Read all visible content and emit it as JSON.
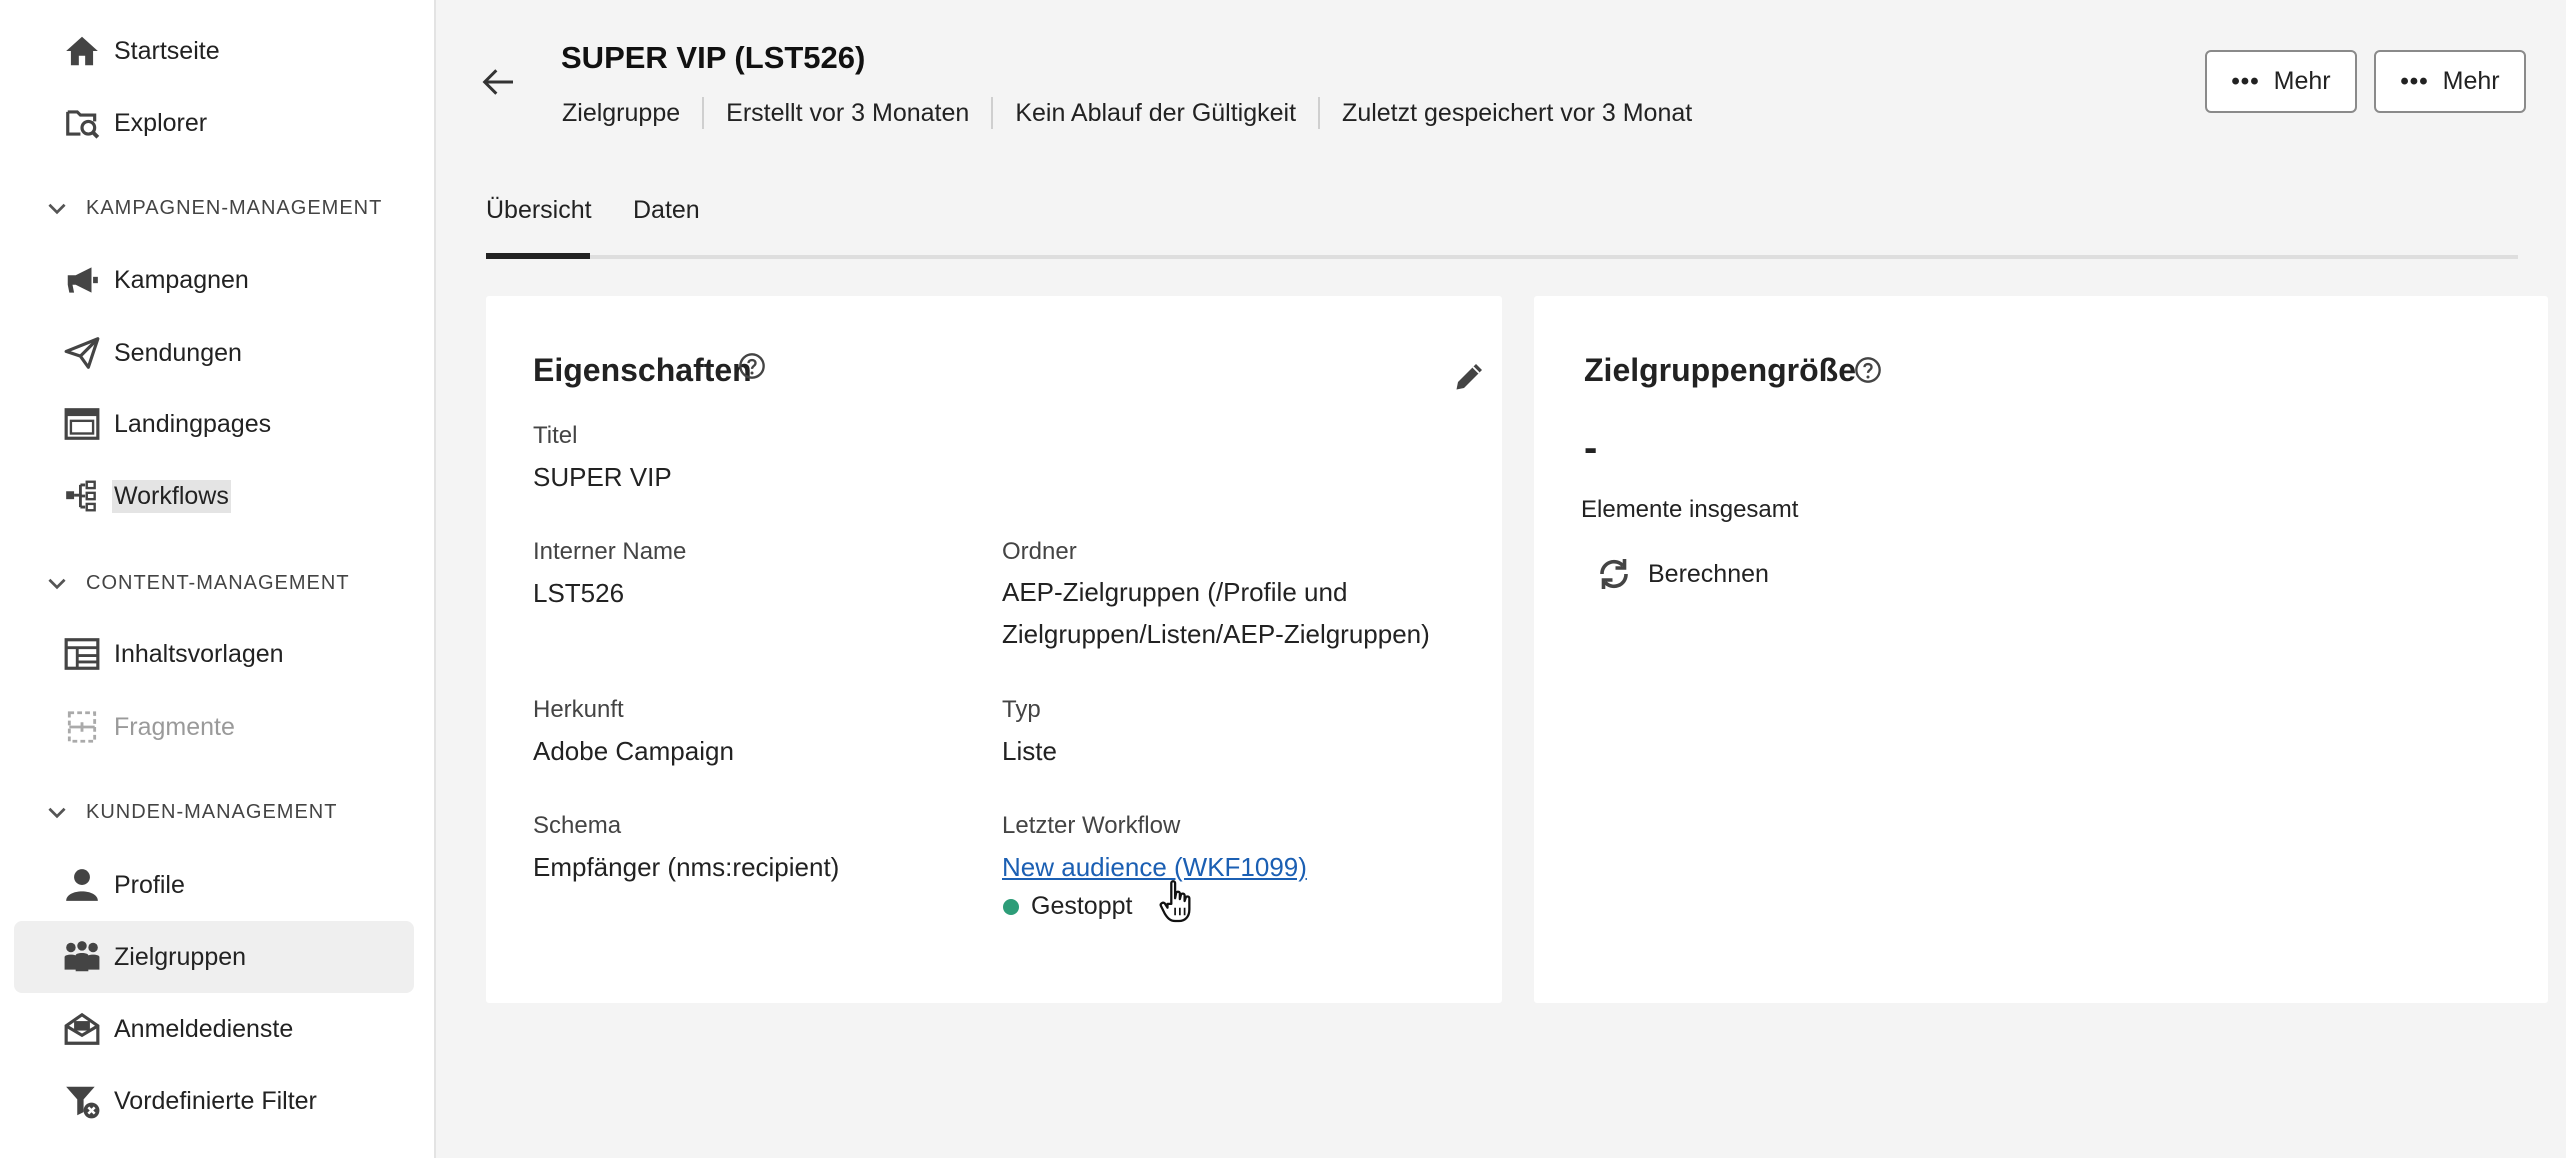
{
  "sidebar": {
    "items": [
      {
        "label": "Startseite",
        "icon": "home-icon"
      },
      {
        "label": "Explorer",
        "icon": "explorer-icon"
      },
      {
        "label": "Kampagnen",
        "icon": "megaphone-icon"
      },
      {
        "label": "Sendungen",
        "icon": "paper-plane-icon"
      },
      {
        "label": "Landingpages",
        "icon": "window-icon"
      },
      {
        "label": "Workflows",
        "icon": "workflow-icon"
      },
      {
        "label": "Inhaltsvorlagen",
        "icon": "template-icon"
      },
      {
        "label": "Fragmente",
        "icon": "fragment-icon"
      },
      {
        "label": "Profile",
        "icon": "user-icon"
      },
      {
        "label": "Zielgruppen",
        "icon": "audience-icon"
      },
      {
        "label": "Anmeldedienste",
        "icon": "subscription-icon"
      },
      {
        "label": "Vordefinierte Filter",
        "icon": "filter-icon"
      }
    ],
    "sections": [
      {
        "label": "KAMPAGNEN-MANAGEMENT"
      },
      {
        "label": "CONTENT-MANAGEMENT"
      },
      {
        "label": "KUNDEN-MANAGEMENT"
      }
    ]
  },
  "header": {
    "title": "SUPER VIP (LST526)",
    "meta": [
      "Zielgruppe",
      "Erstellt vor 3 Monaten",
      "Kein Ablauf der Gültigkeit",
      "Zuletzt gespeichert vor 3 Monat"
    ],
    "more_buttons": [
      "Mehr",
      "Mehr"
    ],
    "more_dots": "•••"
  },
  "tabs": [
    {
      "label": "Übersicht",
      "active": true
    },
    {
      "label": "Daten",
      "active": false
    }
  ],
  "properties": {
    "title": "Eigenschaften",
    "fields": {
      "titel": {
        "label": "Titel",
        "value": "SUPER VIP"
      },
      "interner_name": {
        "label": "Interner Name",
        "value": "LST526"
      },
      "ordner": {
        "label": "Ordner",
        "value": "AEP-Zielgruppen (/Profile und Zielgruppen/Listen/AEP-Zielgruppen)"
      },
      "herkunft": {
        "label": "Herkunft",
        "value": "Adobe Campaign"
      },
      "typ": {
        "label": "Typ",
        "value": "Liste"
      },
      "schema": {
        "label": "Schema",
        "value": "Empfänger (nms:recipient)"
      },
      "letzter_workflow": {
        "label": "Letzter Workflow",
        "value": "New audience (WKF1099)",
        "status": "Gestoppt",
        "status_color": "#2d9d78"
      }
    }
  },
  "audience_size": {
    "title": "Zielgruppengröße",
    "value": "-",
    "caption": "Elemente insgesamt",
    "compute_label": "Berechnen"
  },
  "colors": {
    "link": "#1b5fb3",
    "status_stopped": "#2d9d78",
    "active_nav_bg": "#efefef"
  }
}
